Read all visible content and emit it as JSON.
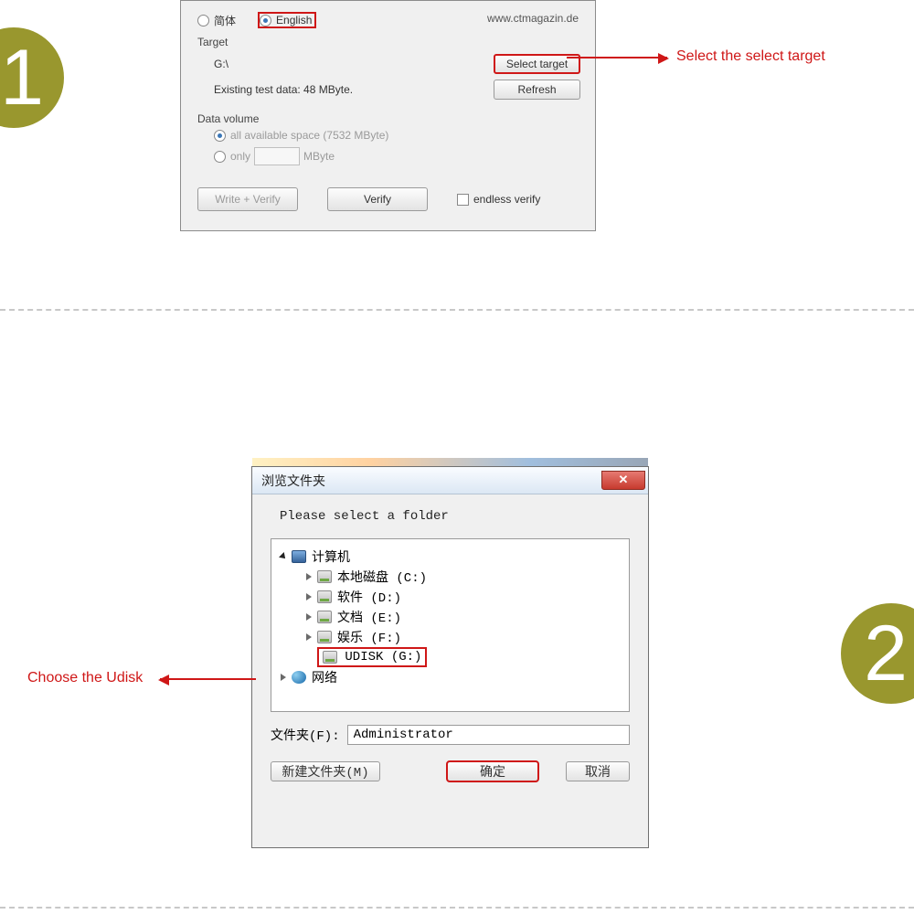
{
  "badges": {
    "one": "1",
    "two": "2"
  },
  "dialog1": {
    "lang": {
      "cn": "简体",
      "en": "English"
    },
    "site": "www.ctmagazin.de",
    "target_label": "Target",
    "target_path": "G:\\",
    "select_target_btn": "Select target",
    "existing_test": "Existing test data: 48 MByte.",
    "refresh_btn": "Refresh",
    "datavol_label": "Data volume",
    "datavol_all": "all available space (7532 MByte)",
    "datavol_only": "only",
    "datavol_unit": "MByte",
    "write_verify_btn": "Write + Verify",
    "verify_btn": "Verify",
    "endless_verify": "endless verify"
  },
  "annotation1": "Select the select target",
  "dialog2": {
    "title": "浏览文件夹",
    "prompt": "Please select a folder",
    "tree": {
      "root": "计算机",
      "drives": [
        "本地磁盘 (C:)",
        "软件 (D:)",
        "文档 (E:)",
        "娱乐 (F:)",
        "UDISK (G:)"
      ],
      "network": "网络"
    },
    "folder_label": "文件夹(F):",
    "folder_value": "Administrator",
    "new_folder_btn": "新建文件夹(M)",
    "ok_btn": "确定",
    "cancel_btn": "取消"
  },
  "annotation2": "Choose the Udisk"
}
